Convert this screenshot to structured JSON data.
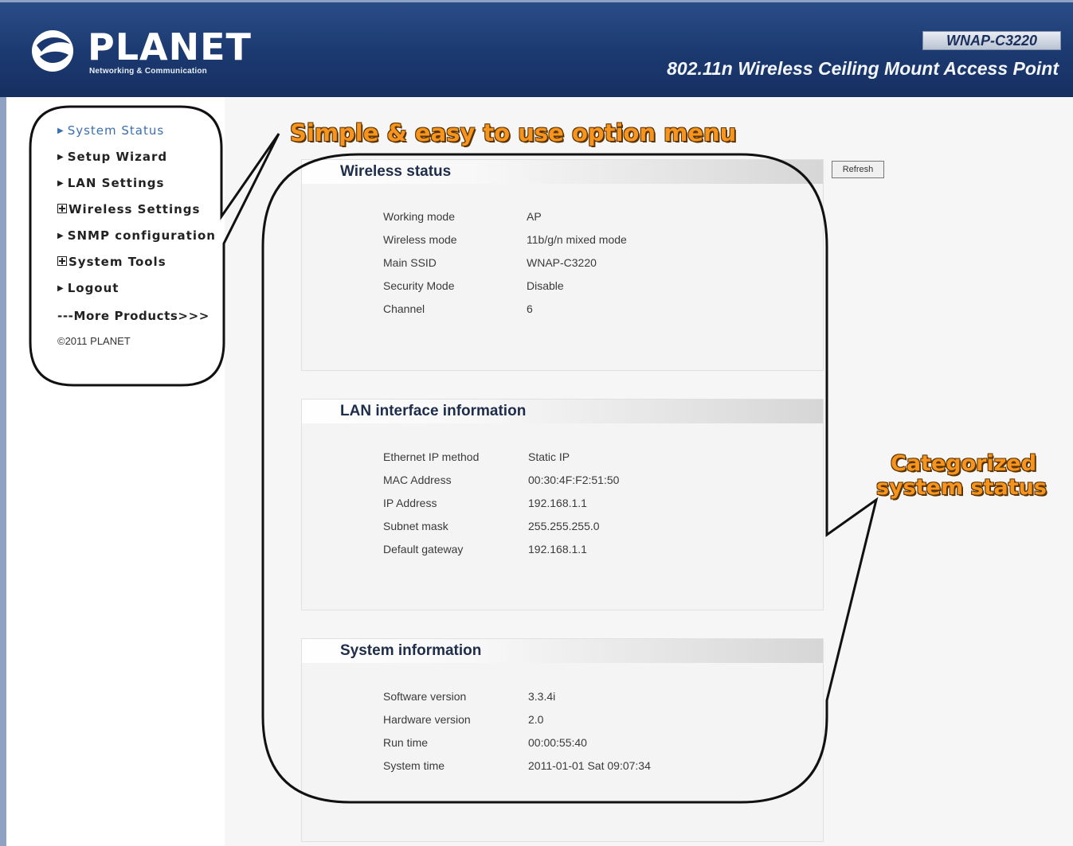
{
  "header": {
    "brand": "PLANET",
    "brand_sub": "Networking & Communication",
    "model": "WNAP-C3220",
    "product_title": "802.11n Wireless Ceiling Mount Access Point"
  },
  "sidebar": {
    "items": [
      {
        "label": "System Status",
        "marker": "arrow",
        "active": true
      },
      {
        "label": "Setup Wizard",
        "marker": "arrow"
      },
      {
        "label": "LAN Settings",
        "marker": "arrow"
      },
      {
        "label": "Wireless Settings",
        "marker": "plus"
      },
      {
        "label": "SNMP configuration",
        "marker": "arrow"
      },
      {
        "label": "System Tools",
        "marker": "plus"
      },
      {
        "label": "Logout",
        "marker": "arrow"
      }
    ],
    "more_products": "---More Products>>>",
    "copyright": "©2011 PLANET"
  },
  "content": {
    "refresh_label": "Refresh",
    "wireless": {
      "title": "Wireless status",
      "rows": [
        {
          "k": "Working mode",
          "v": "AP"
        },
        {
          "k": "Wireless mode",
          "v": "11b/g/n mixed mode"
        },
        {
          "k": "Main SSID",
          "v": "WNAP-C3220"
        },
        {
          "k": "Security Mode",
          "v": "Disable"
        },
        {
          "k": "Channel",
          "v": "6"
        }
      ]
    },
    "lan": {
      "title": "LAN interface information",
      "rows": [
        {
          "k": "Ethernet IP method",
          "v": "Static IP"
        },
        {
          "k": "MAC Address",
          "v": "00:30:4F:F2:51:50"
        },
        {
          "k": "IP Address",
          "v": "192.168.1.1"
        },
        {
          "k": "Subnet mask",
          "v": "255.255.255.0"
        },
        {
          "k": "Default gateway",
          "v": "192.168.1.1"
        }
      ]
    },
    "system": {
      "title": "System information",
      "rows": [
        {
          "k": "Software version",
          "v": "3.3.4i"
        },
        {
          "k": "Hardware version",
          "v": "2.0"
        },
        {
          "k": "Run time",
          "v": "00:00:55:40"
        },
        {
          "k": "System time",
          "v": "2011-01-01 Sat 09:07:34"
        }
      ]
    }
  },
  "annotations": {
    "menu": "Simple & easy to use option menu",
    "categorized_line1": "Categorized",
    "categorized_line2": "system status",
    "color": "#f7941d"
  }
}
